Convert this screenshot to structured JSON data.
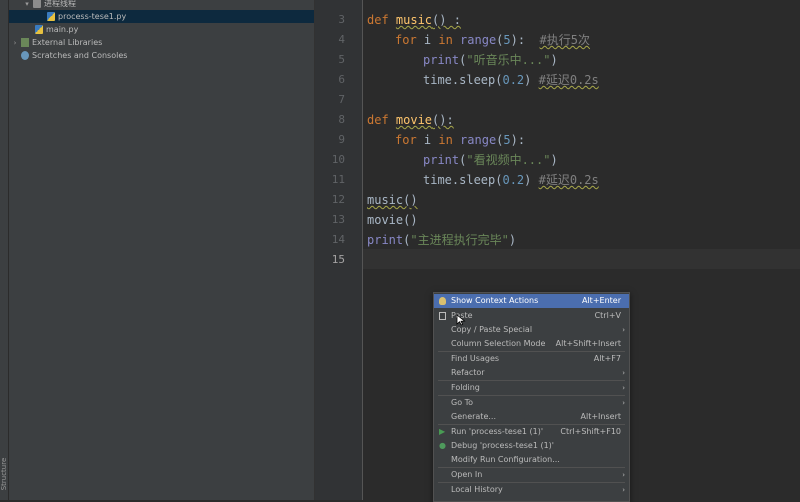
{
  "project_tree": {
    "items": [
      {
        "label": "进程线程",
        "type": "folder",
        "expanded": true
      },
      {
        "label": "process-tese1.py",
        "type": "py"
      },
      {
        "label": "main.py",
        "type": "py"
      },
      {
        "label": "External Libraries",
        "type": "lib"
      },
      {
        "label": "Scratches and Consoles",
        "type": "scratch"
      }
    ]
  },
  "structure_tab": {
    "label": "Structure"
  },
  "editor": {
    "line_numbers": [
      "3",
      "4",
      "5",
      "6",
      "7",
      "8",
      "9",
      "10",
      "11",
      "12",
      "13",
      "14",
      "15"
    ],
    "current_line": "15",
    "lines": {
      "l3": {
        "kw": "def ",
        "name": "music",
        "rest": "() :"
      },
      "l4": {
        "kw1": "for ",
        "var": "i ",
        "kw2": "in ",
        "fn": "range",
        "p1": "(",
        "num": "5",
        "p2": "):  ",
        "cmt": "#执行5次"
      },
      "l5": {
        "fn": "print",
        "p1": "(",
        "str": "\"听音乐中...\"",
        "p2": ")"
      },
      "l6": {
        "obj": "time.sleep(",
        "num": "0.2",
        "p2": ") ",
        "cmt": "#延迟0.2s"
      },
      "l8": {
        "kw": "def ",
        "name": "movie",
        "rest": "():"
      },
      "l9": {
        "kw1": "for ",
        "var": "i ",
        "kw2": "in ",
        "fn": "range",
        "p1": "(",
        "num": "5",
        "p2": "):"
      },
      "l10": {
        "fn": "print",
        "p1": "(",
        "str": "\"看视频中...\"",
        "p2": ")"
      },
      "l11": {
        "obj": "time.sleep(",
        "num": "0.2",
        "p2": ") ",
        "cmt": "#延迟0.2s"
      },
      "l12": {
        "text": "music()"
      },
      "l13": {
        "text": "movie()"
      },
      "l14": {
        "fn": "print",
        "p1": "(",
        "str": "\"主进程执行完毕\"",
        "p2": ")"
      }
    }
  },
  "context_menu": {
    "items": [
      {
        "label": "Show Context Actions",
        "shortcut": "Alt+Enter",
        "highlighted": true,
        "icon": "bulb-icon"
      },
      {
        "label": "Paste",
        "shortcut": "Ctrl+V",
        "icon": "paste-icon"
      },
      {
        "label": "Copy / Paste Special",
        "submenu": true
      },
      {
        "label": "Column Selection Mode",
        "shortcut": "Alt+Shift+Insert"
      },
      {
        "label": "Find Usages",
        "shortcut": "Alt+F7"
      },
      {
        "label": "Refactor",
        "submenu": true
      },
      {
        "label": "Folding",
        "submenu": true
      },
      {
        "label": "Go To",
        "submenu": true
      },
      {
        "label": "Generate...",
        "shortcut": "Alt+Insert"
      },
      {
        "label": "Run 'process-tese1 (1)'",
        "shortcut": "Ctrl+Shift+F10",
        "icon": "run-icon"
      },
      {
        "label": "Debug 'process-tese1 (1)'",
        "icon": "debug-icon"
      },
      {
        "label": "Modify Run Configuration..."
      },
      {
        "label": "Open In",
        "submenu": true
      },
      {
        "label": "Local History",
        "submenu": true
      }
    ],
    "arrow_glyph": "›"
  },
  "colors": {
    "highlight": "#4b6eaf",
    "keyword": "#cc7832",
    "function": "#ffc66d",
    "string": "#6a8759",
    "number": "#6897bb",
    "comment": "#808080"
  }
}
